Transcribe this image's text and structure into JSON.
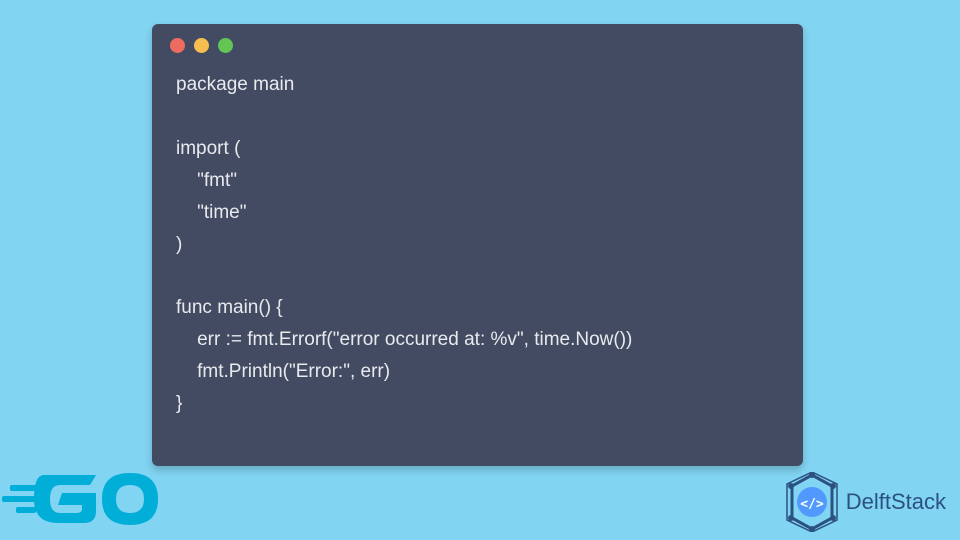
{
  "window": {
    "controls": [
      "red",
      "yellow",
      "green"
    ]
  },
  "code": {
    "lines": [
      "package main",
      "",
      "import (",
      "    \"fmt\"",
      "    \"time\"",
      ")",
      "",
      "func main() {",
      "    err := fmt.Errorf(\"error occurred at: %v\", time.Now())",
      "    fmt.Println(\"Error:\", err)",
      "}"
    ]
  },
  "go_logo": {
    "text": "GO",
    "color": "#00aed8"
  },
  "brand": {
    "name": "DelftStack",
    "icon_symbol": "</>",
    "color": "#2c5282"
  }
}
